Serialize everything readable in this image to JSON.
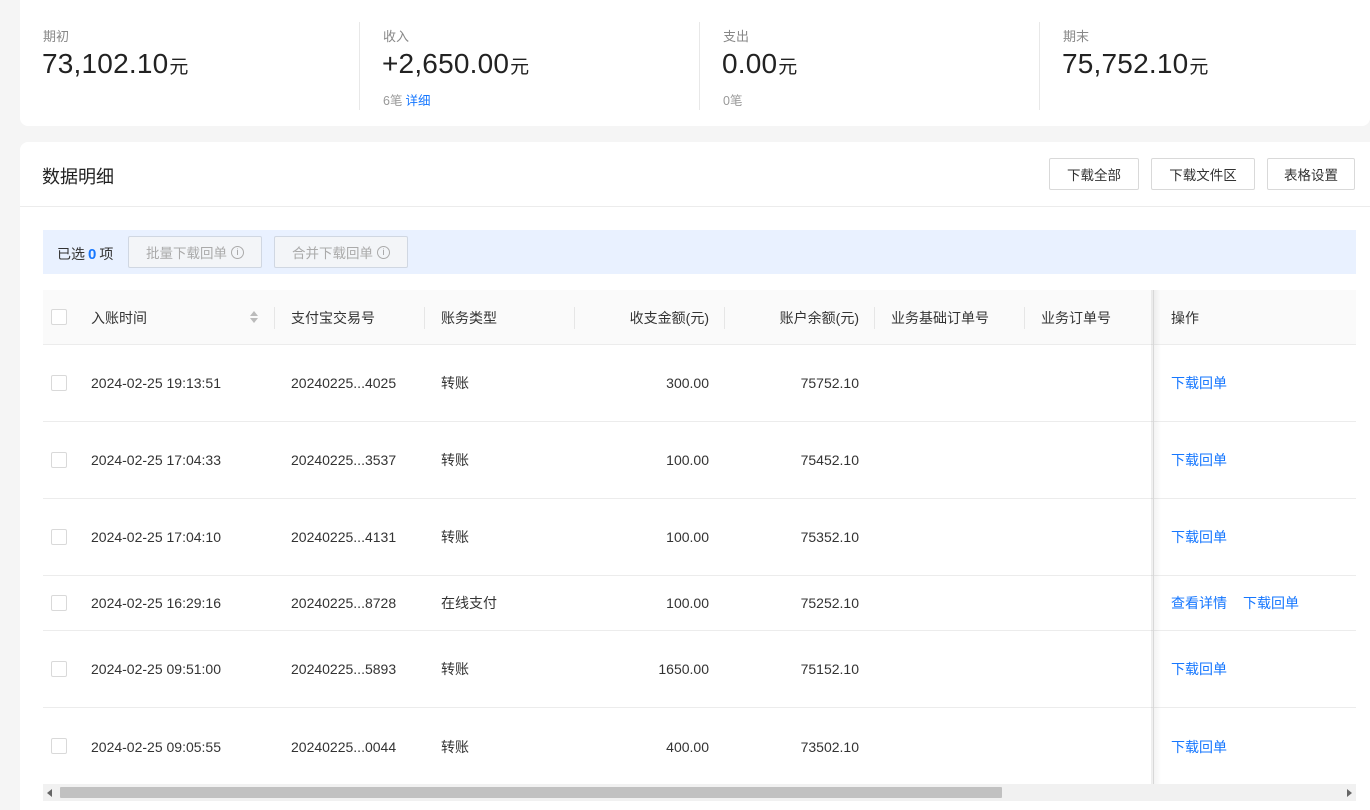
{
  "summary": {
    "opening": {
      "label": "期初",
      "value": "73,102.10",
      "unit": "元"
    },
    "income": {
      "label": "收入",
      "value": "+2,650.00",
      "unit": "元",
      "count": "6笔",
      "detail_link": "详细"
    },
    "expense": {
      "label": "支出",
      "value": "0.00",
      "unit": "元",
      "count": "0笔"
    },
    "closing": {
      "label": "期末",
      "value": "75,752.10",
      "unit": "元"
    }
  },
  "details": {
    "title": "数据明细",
    "buttons": {
      "download_all": "下载全部",
      "download_files": "下载文件区",
      "table_settings": "表格设置"
    },
    "selection": {
      "prefix": "已选",
      "count": "0",
      "suffix": "项",
      "batch_download": "批量下载回单",
      "merge_download": "合并下载回单"
    }
  },
  "table": {
    "columns": {
      "time": "入账时间",
      "trade_no": "支付宝交易号",
      "type": "账务类型",
      "amount": "收支金额(元)",
      "balance": "账户余额(元)",
      "base_order": "业务基础订单号",
      "order": "业务订单号",
      "action": "操作"
    },
    "rows": [
      {
        "time": "2024-02-25 19:13:51",
        "trade_no": "20240225...4025",
        "type": "转账",
        "amount": "300.00",
        "balance": "75752.10",
        "view": "",
        "download": "下载回单"
      },
      {
        "time": "2024-02-25 17:04:33",
        "trade_no": "20240225...3537",
        "type": "转账",
        "amount": "100.00",
        "balance": "75452.10",
        "view": "",
        "download": "下载回单"
      },
      {
        "time": "2024-02-25 17:04:10",
        "trade_no": "20240225...4131",
        "type": "转账",
        "amount": "100.00",
        "balance": "75352.10",
        "view": "",
        "download": "下载回单"
      },
      {
        "time": "2024-02-25 16:29:16",
        "trade_no": "20240225...8728",
        "type": "在线支付",
        "amount": "100.00",
        "balance": "75252.10",
        "view": "查看详情",
        "download": "下载回单"
      },
      {
        "time": "2024-02-25 09:51:00",
        "trade_no": "20240225...5893",
        "type": "转账",
        "amount": "1650.00",
        "balance": "75152.10",
        "view": "",
        "download": "下载回单"
      },
      {
        "time": "2024-02-25 09:05:55",
        "trade_no": "20240225...0044",
        "type": "转账",
        "amount": "400.00",
        "balance": "73502.10",
        "view": "",
        "download": "下载回单"
      }
    ]
  },
  "colors": {
    "accent": "#1677ff",
    "selection_bar": "#e9f1ff",
    "page_bg": "#f5f5f5"
  }
}
